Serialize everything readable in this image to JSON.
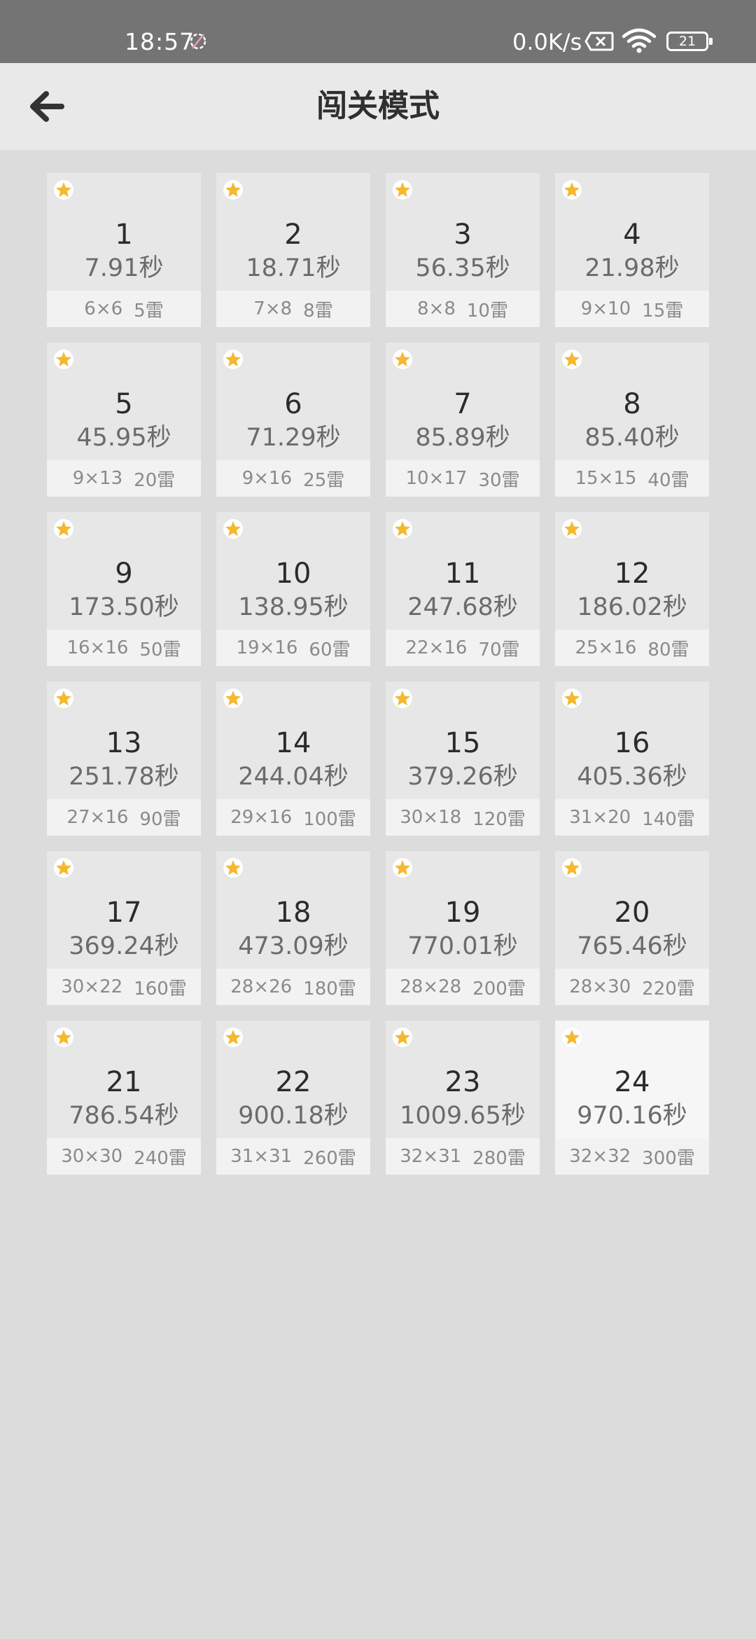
{
  "status": {
    "time": "18:57",
    "net_speed": "0.0K/s",
    "battery": "21"
  },
  "header": {
    "title": "闯关模式"
  },
  "colors": {
    "star": "#f5b82e",
    "selected_card": "#f6f6f6",
    "card": "#e7e7e7"
  },
  "levels": [
    {
      "number": "1",
      "time": "7.91秒",
      "size": "6×6",
      "mines": "5雷"
    },
    {
      "number": "2",
      "time": "18.71秒",
      "size": "7×8",
      "mines": "8雷"
    },
    {
      "number": "3",
      "time": "56.35秒",
      "size": "8×8",
      "mines": "10雷"
    },
    {
      "number": "4",
      "time": "21.98秒",
      "size": "9×10",
      "mines": "15雷"
    },
    {
      "number": "5",
      "time": "45.95秒",
      "size": "9×13",
      "mines": "20雷"
    },
    {
      "number": "6",
      "time": "71.29秒",
      "size": "9×16",
      "mines": "25雷"
    },
    {
      "number": "7",
      "time": "85.89秒",
      "size": "10×17",
      "mines": "30雷"
    },
    {
      "number": "8",
      "time": "85.40秒",
      "size": "15×15",
      "mines": "40雷"
    },
    {
      "number": "9",
      "time": "173.50秒",
      "size": "16×16",
      "mines": "50雷"
    },
    {
      "number": "10",
      "time": "138.95秒",
      "size": "19×16",
      "mines": "60雷"
    },
    {
      "number": "11",
      "time": "247.68秒",
      "size": "22×16",
      "mines": "70雷"
    },
    {
      "number": "12",
      "time": "186.02秒",
      "size": "25×16",
      "mines": "80雷"
    },
    {
      "number": "13",
      "time": "251.78秒",
      "size": "27×16",
      "mines": "90雷"
    },
    {
      "number": "14",
      "time": "244.04秒",
      "size": "29×16",
      "mines": "100雷"
    },
    {
      "number": "15",
      "time": "379.26秒",
      "size": "30×18",
      "mines": "120雷"
    },
    {
      "number": "16",
      "time": "405.36秒",
      "size": "31×20",
      "mines": "140雷"
    },
    {
      "number": "17",
      "time": "369.24秒",
      "size": "30×22",
      "mines": "160雷"
    },
    {
      "number": "18",
      "time": "473.09秒",
      "size": "28×26",
      "mines": "180雷"
    },
    {
      "number": "19",
      "time": "770.01秒",
      "size": "28×28",
      "mines": "200雷"
    },
    {
      "number": "20",
      "time": "765.46秒",
      "size": "28×30",
      "mines": "220雷"
    },
    {
      "number": "21",
      "time": "786.54秒",
      "size": "30×30",
      "mines": "240雷"
    },
    {
      "number": "22",
      "time": "900.18秒",
      "size": "31×31",
      "mines": "260雷"
    },
    {
      "number": "23",
      "time": "1009.65秒",
      "size": "32×31",
      "mines": "280雷"
    },
    {
      "number": "24",
      "time": "970.16秒",
      "size": "32×32",
      "mines": "300雷",
      "selected": true
    }
  ]
}
